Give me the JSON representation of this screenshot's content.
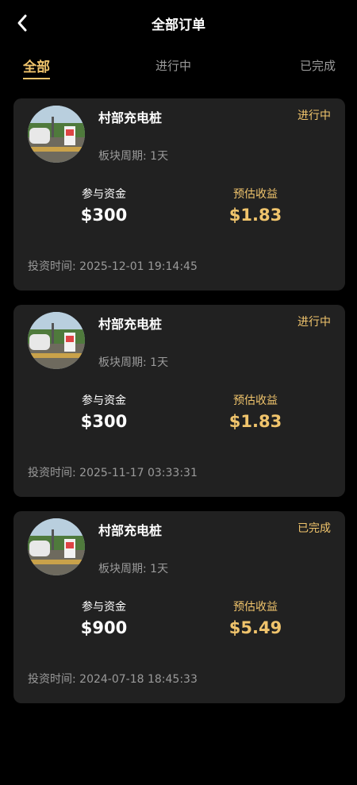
{
  "header": {
    "title": "全部订单"
  },
  "tabs": [
    {
      "label": "全部",
      "active": true
    },
    {
      "label": "进行中",
      "active": false
    },
    {
      "label": "已完成",
      "active": false
    }
  ],
  "colors": {
    "accent": "#f0c46c",
    "card_bg": "#212121",
    "page_bg": "#000000",
    "muted": "#9a9a9a"
  },
  "orders": [
    {
      "name": "村部充电桩",
      "status": "进行中",
      "cycle": "板块周期: 1天",
      "capital_label": "参与资金",
      "capital": "$300",
      "yield_label": "预估收益",
      "yield": "$1.83",
      "time": "投资时间: 2025-12-01 19:14:45"
    },
    {
      "name": "村部充电桩",
      "status": "进行中",
      "cycle": "板块周期: 1天",
      "capital_label": "参与资金",
      "capital": "$300",
      "yield_label": "预估收益",
      "yield": "$1.83",
      "time": "投资时间: 2025-11-17 03:33:31"
    },
    {
      "name": "村部充电桩",
      "status": "已完成",
      "cycle": "板块周期: 1天",
      "capital_label": "参与资金",
      "capital": "$900",
      "yield_label": "预估收益",
      "yield": "$5.49",
      "time": "投资时间: 2024-07-18 18:45:33"
    }
  ]
}
